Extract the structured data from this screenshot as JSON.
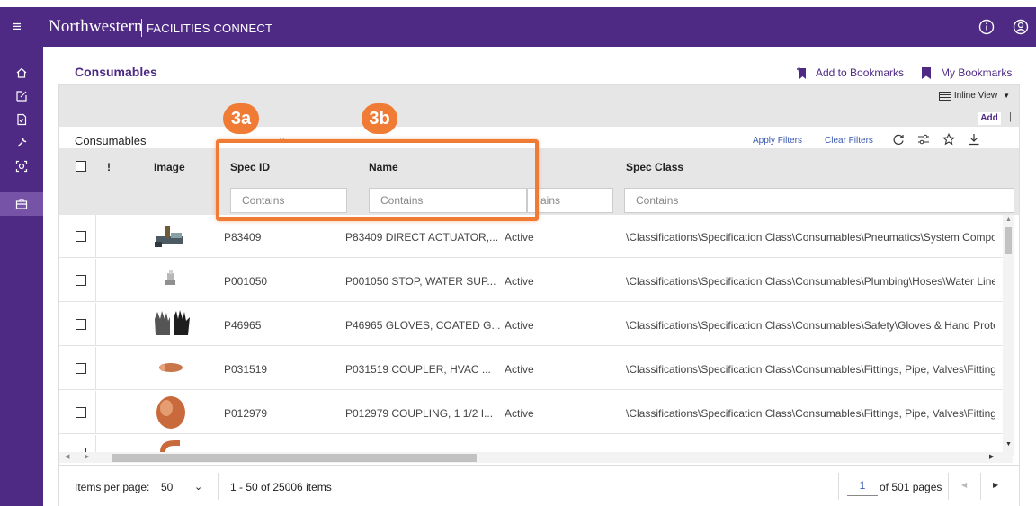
{
  "app": {
    "brand": "Northwestern",
    "subtitle": "FACILITIES CONNECT"
  },
  "page": {
    "title": "Consumables",
    "add_bookmarks": "Add to Bookmarks",
    "my_bookmarks": "My Bookmarks"
  },
  "toolbar": {
    "inline_view": "Inline View",
    "add": "Add",
    "add_separator": "|",
    "view_name": "Consumables",
    "apply_filters": "Apply Filters",
    "clear_filters": "Clear Filters"
  },
  "grid": {
    "columns": {
      "flag": "!",
      "image": "Image",
      "spec_id": "Spec ID",
      "name": "Name",
      "spec_class": "Spec Class"
    },
    "filter_placeholder": "Contains",
    "status_filter_fragment": "ains",
    "rows": [
      {
        "spec_id": "P83409",
        "name": "P83409 DIRECT ACTUATOR,...",
        "status": "Active",
        "spec_class": "\\Classifications\\Specification Class\\Consumables\\Pneumatics\\System Compor"
      },
      {
        "spec_id": "P001050",
        "name": "P001050 STOP, WATER SUP...",
        "status": "Active",
        "spec_class": "\\Classifications\\Specification Class\\Consumables\\Plumbing\\Hoses\\Water Line"
      },
      {
        "spec_id": "P46965",
        "name": "P46965 GLOVES, COATED G...",
        "status": "Active",
        "spec_class": "\\Classifications\\Specification Class\\Consumables\\Safety\\Gloves & Hand Protec"
      },
      {
        "spec_id": "P031519",
        "name": "P031519 COUPLER, HVAC ...",
        "status": "Active",
        "spec_class": "\\Classifications\\Specification Class\\Consumables\\Fittings, Pipe, Valves\\Fittings"
      },
      {
        "spec_id": "P012979",
        "name": "P012979 COUPLING, 1 1/2 I...",
        "status": "Active",
        "spec_class": "\\Classifications\\Specification Class\\Consumables\\Fittings, Pipe, Valves\\Fittings"
      }
    ]
  },
  "pager": {
    "items_per_page_label": "Items per page:",
    "items_per_page_value": "50",
    "range_text": "1 - 50 of 25006 items",
    "current_page": "1",
    "total_pages_text": "of 501 pages"
  },
  "callouts": {
    "a": "3a",
    "b": "3b"
  },
  "colors": {
    "brand_purple": "#4e2a84",
    "callout_orange": "#ef7b35",
    "link_blue": "#3a58b0"
  },
  "icons": [
    "hamburger-icon",
    "info-icon",
    "account-icon",
    "home-icon",
    "edit-icon",
    "document-icon",
    "wrench-icon",
    "scan-icon",
    "briefcase-icon",
    "bookmark-add-icon",
    "bookmark-icon",
    "refresh-icon",
    "filter-settings-icon",
    "star-icon",
    "download-icon",
    "chevron-down-icon"
  ]
}
